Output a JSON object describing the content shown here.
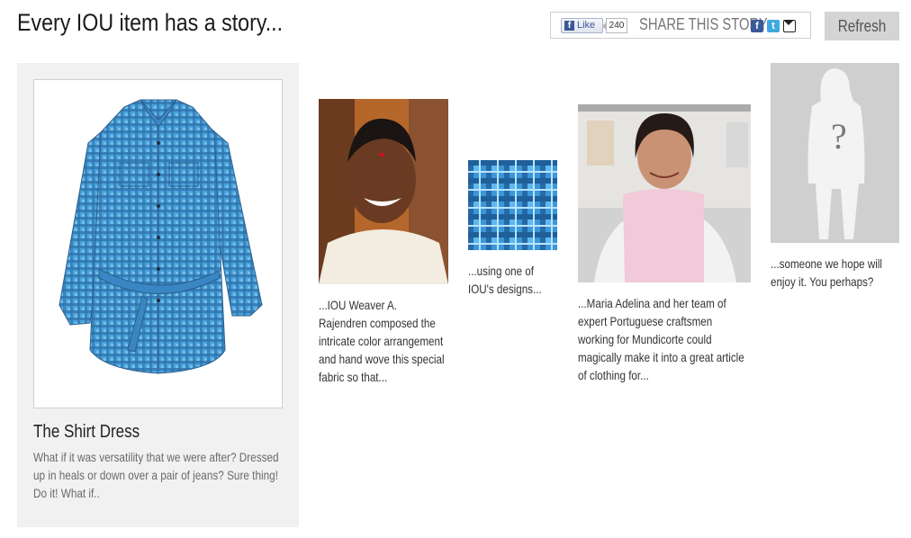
{
  "header": {
    "title": "Every IOU item has a story...",
    "like_label": "Like",
    "like_count": "240",
    "share_label": "SHARE THIS STORY",
    "social_icons": [
      "facebook-icon",
      "twitter-icon",
      "email-icon"
    ],
    "refresh_label": "Refresh"
  },
  "feature": {
    "title": "The Shirt Dress",
    "description": "What if it was versatility that we were after? Dressed up in heals or down over a pair of jeans? Sure thing! Do it! What if.."
  },
  "story": [
    {
      "caption": "...IOU Weaver A. Rajendren composed the intricate color arrangement and hand wove this special fabric so that..."
    },
    {
      "caption": "...using one of IOU's designs..."
    },
    {
      "caption": "...Maria Adelina and her team of expert Portuguese craftsmen working for Mundicorte could magically make it into a great article of clothing for..."
    },
    {
      "caption": "...someone we hope will enjoy it. You perhaps?",
      "silhouette_mark": "?"
    }
  ],
  "colors": {
    "accent_blue": "#3f8fd0",
    "panel_gray": "#f1f1f1",
    "button_gray": "#d4d4d4",
    "silhouette_bg": "#cfcfcf"
  }
}
